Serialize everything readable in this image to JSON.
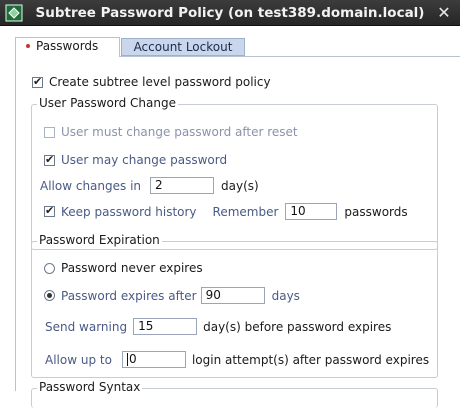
{
  "window": {
    "title": "Subtree Password Policy (on test389.domain.local)"
  },
  "tabs": [
    {
      "label": "Passwords",
      "selected": true
    },
    {
      "label": "Account Lockout",
      "selected": false
    }
  ],
  "create_policy": {
    "label": "Create subtree level password policy",
    "checked": true
  },
  "user_change_group": {
    "title": "User Password Change",
    "must_change": {
      "label": "User must change password after reset",
      "checked": false,
      "enabled": false
    },
    "may_change": {
      "label": "User may change password",
      "checked": true
    },
    "allow_changes": {
      "label": "Allow changes in",
      "value": "2",
      "unit": "day(s)"
    },
    "keep_history": {
      "label": "Keep password history",
      "checked": true,
      "remember_label": "Remember",
      "remember_value": "10",
      "unit": "passwords"
    }
  },
  "expiration_group": {
    "title": "Password Expiration",
    "never_expires": {
      "label": "Password never expires",
      "selected": false
    },
    "expires_after": {
      "label": "Password expires after",
      "value": "90",
      "unit": "days",
      "selected": true
    },
    "send_warning": {
      "label": "Send warning",
      "value": "15",
      "suffix": "day(s) before password expires"
    },
    "allow_up_to": {
      "label": "Allow up to",
      "value": "0",
      "suffix": "login attempt(s) after password expires"
    }
  },
  "next_group": {
    "title": "Password Syntax"
  },
  "colors": {
    "titlebar": "#2f2f2f",
    "tab_inactive": "#c9d6ec",
    "label_blue": "#4a5a86"
  }
}
